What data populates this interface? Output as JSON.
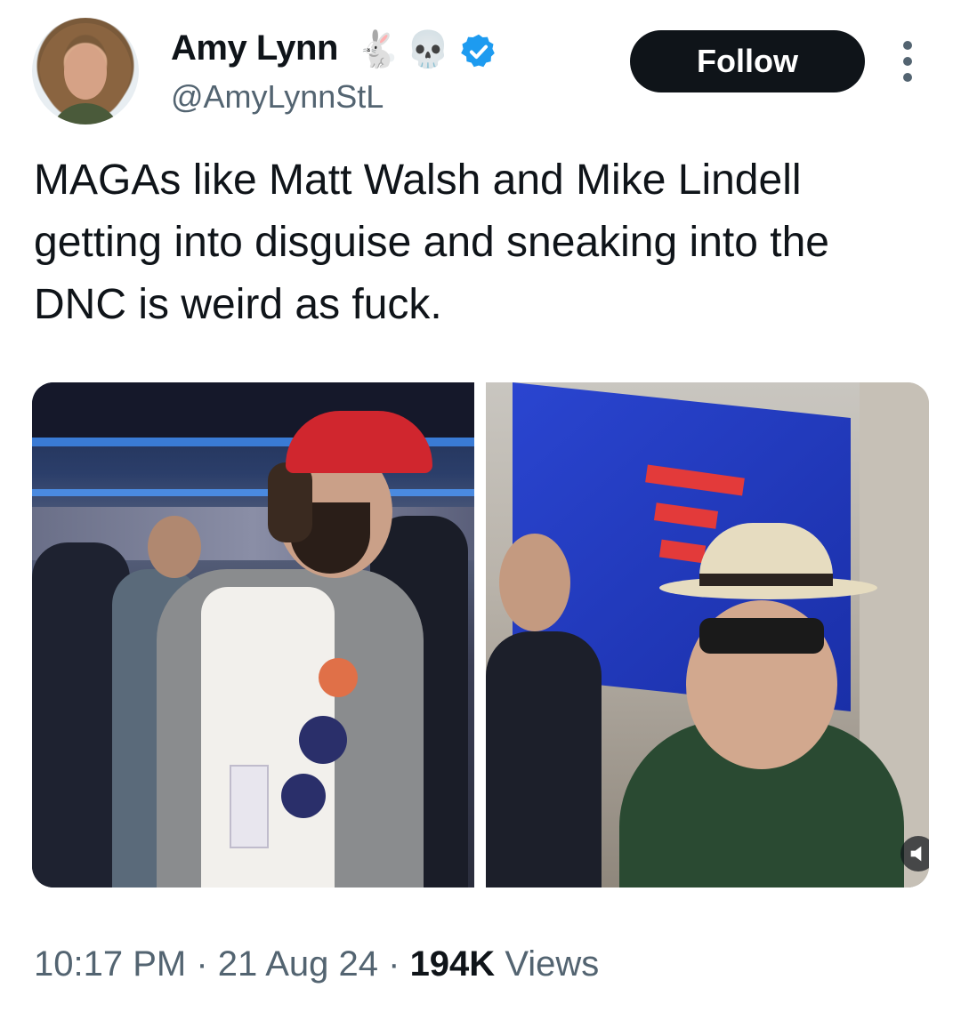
{
  "author": {
    "display_name": "Amy Lynn",
    "name_emojis": [
      "🐇",
      "💀"
    ],
    "handle": "@AmyLynnStL",
    "verified": true
  },
  "header": {
    "follow_label": "Follow"
  },
  "tweet": {
    "text": "MAGAs like Matt Walsh and Mike Lindell getting into disguise and sneaking into the DNC is weird as fuck.",
    "media": [
      {
        "icon": "photo-convention-floor"
      },
      {
        "icon": "video-dnc-hallway"
      }
    ]
  },
  "meta": {
    "time": "10:17 PM",
    "date": "21 Aug 24",
    "views_count": "194K",
    "views_label": "Views",
    "separator": "·"
  },
  "colors": {
    "text": "#0f1419",
    "muted": "#536471",
    "verified": "#1d9bf0",
    "button": "#0f1419"
  }
}
